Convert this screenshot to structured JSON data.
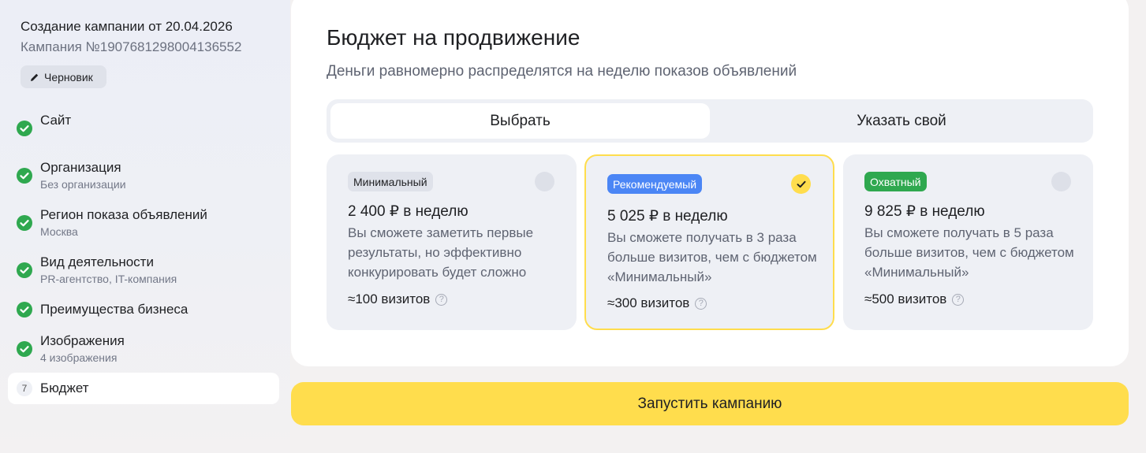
{
  "sidebar": {
    "campaign_title": "Создание кампании от 20.04.2026",
    "campaign_number": "Кампания №1907681298004136552",
    "draft_label": "Черновик",
    "steps": [
      {
        "title": "Сайт",
        "subtitle": "",
        "status": "done"
      },
      {
        "title": "Организация",
        "subtitle": "Без организации",
        "status": "done"
      },
      {
        "title": "Регион показа объявлений",
        "subtitle": "Москва",
        "status": "done"
      },
      {
        "title": "Вид деятельности",
        "subtitle": "PR-агентство, IT-компания",
        "status": "done"
      },
      {
        "title": "Преимущества бизнеса",
        "subtitle": "",
        "status": "done"
      },
      {
        "title": "Изображения",
        "subtitle": "4 изображения",
        "status": "done"
      },
      {
        "title": "Бюджет",
        "subtitle": "",
        "status": "active",
        "number": "7"
      }
    ]
  },
  "main": {
    "title": "Бюджет на продвижение",
    "subtitle": "Деньги равномерно распределятся на неделю показов объявлений",
    "tabs": [
      {
        "label": "Выбрать",
        "selected": true
      },
      {
        "label": "Указать свой",
        "selected": false
      }
    ],
    "plans": [
      {
        "badge": "Минимальный",
        "price": "2 400 ₽ в неделю",
        "description": "Вы сможете заметить первые результаты, но эффективно конкурировать будет сложно",
        "visits": "≈100 визитов",
        "selected": false
      },
      {
        "badge": "Рекомендуемый",
        "price": "5 025 ₽ в неделю",
        "description": "Вы сможете получать в 3 раза больше визитов, чем с бюджетом «Минимальный»",
        "visits": "≈300 визитов",
        "selected": true
      },
      {
        "badge": "Охватный",
        "price": "9 825 ₽ в неделю",
        "description": "Вы сможете получать в 5 раза больше визитов, чем с бюджетом «Минимальный»",
        "visits": "≈500 визитов",
        "selected": false
      }
    ],
    "launch_button": "Запустить кампанию"
  },
  "colors": {
    "accent_yellow": "#ffdd4d",
    "check_green": "#2fa84f",
    "badge_blue": "#4b86f5",
    "badge_green": "#2fa84f"
  }
}
